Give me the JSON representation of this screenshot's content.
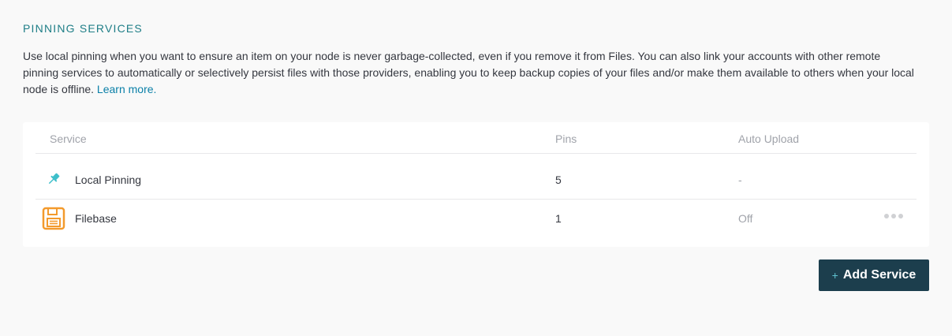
{
  "section": {
    "title": "PINNING SERVICES",
    "description": "Use local pinning when you want to ensure an item on your node is never garbage-collected, even if you remove it from Files. You can also link your accounts with other remote pinning services to automatically or selectively persist files with those providers, enabling you to keep backup copies of your files and/or make them available to others when your local node is offline.",
    "learn_more": "Learn more."
  },
  "table": {
    "columns": {
      "service": "Service",
      "pins": "Pins",
      "auto_upload": "Auto Upload"
    },
    "rows": [
      {
        "service": "Local Pinning",
        "pins": "5",
        "auto_upload": "-",
        "icon": "pin-icon"
      },
      {
        "service": "Filebase",
        "pins": "1",
        "auto_upload": "Off",
        "icon": "filebase-icon"
      }
    ]
  },
  "actions": {
    "add_service_plus": "+",
    "add_service_label": "Add Service"
  },
  "colors": {
    "accent": "#1f7e87",
    "link": "#0b80a8",
    "button_bg": "#1c3e4d",
    "pin_icon": "#3ebfca",
    "filebase_icon": "#f39a2c"
  }
}
